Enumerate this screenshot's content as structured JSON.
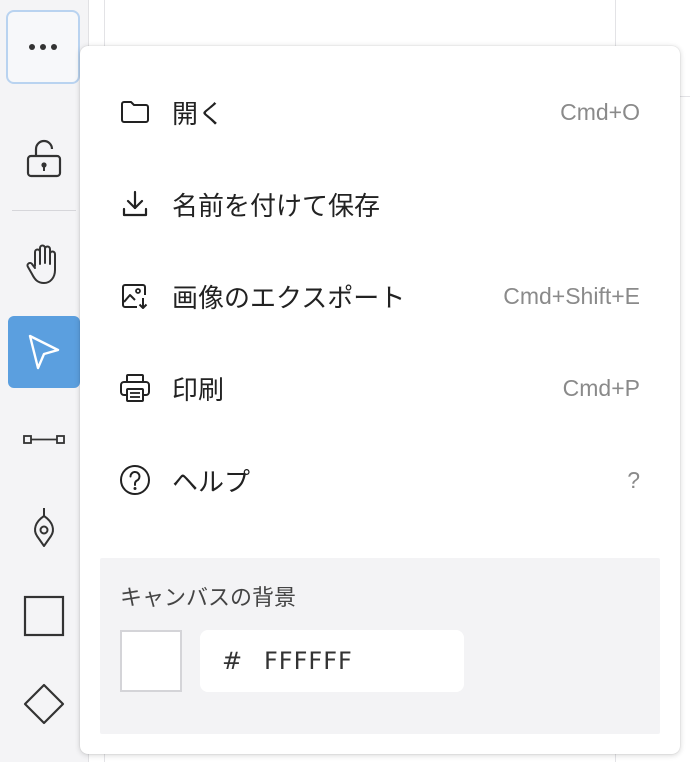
{
  "toolbar": {
    "items": [
      {
        "name": "more-options",
        "icon": "ellipsis-icon"
      },
      {
        "name": "lock",
        "icon": "unlocked-padlock-icon"
      },
      {
        "name": "hand",
        "icon": "hand-icon",
        "label": ""
      },
      {
        "name": "select",
        "icon": "cursor-arrow-icon",
        "active": true
      },
      {
        "name": "connector",
        "icon": "connector-line-icon"
      },
      {
        "name": "pen",
        "icon": "pen-nib-icon"
      },
      {
        "name": "rectangle",
        "icon": "square-icon"
      },
      {
        "name": "diamond",
        "icon": "diamond-icon"
      }
    ],
    "active_color": "#5b9fdf"
  },
  "menu": {
    "items": [
      {
        "label": "開く",
        "shortcut": "Cmd+O",
        "icon": "folder-icon"
      },
      {
        "label": "名前を付けて保存",
        "shortcut": "",
        "icon": "download-icon"
      },
      {
        "label": "画像のエクスポート",
        "shortcut": "Cmd+Shift+E",
        "icon": "image-export-icon"
      },
      {
        "label": "印刷",
        "shortcut": "Cmd+P",
        "icon": "printer-icon"
      },
      {
        "label": "ヘルプ",
        "shortcut": "?",
        "icon": "help-circle-icon"
      }
    ],
    "canvas_background": {
      "title": "キャンバスの背景",
      "hash": "#",
      "value": "FFFFFF",
      "swatch_color": "#ffffff"
    }
  }
}
